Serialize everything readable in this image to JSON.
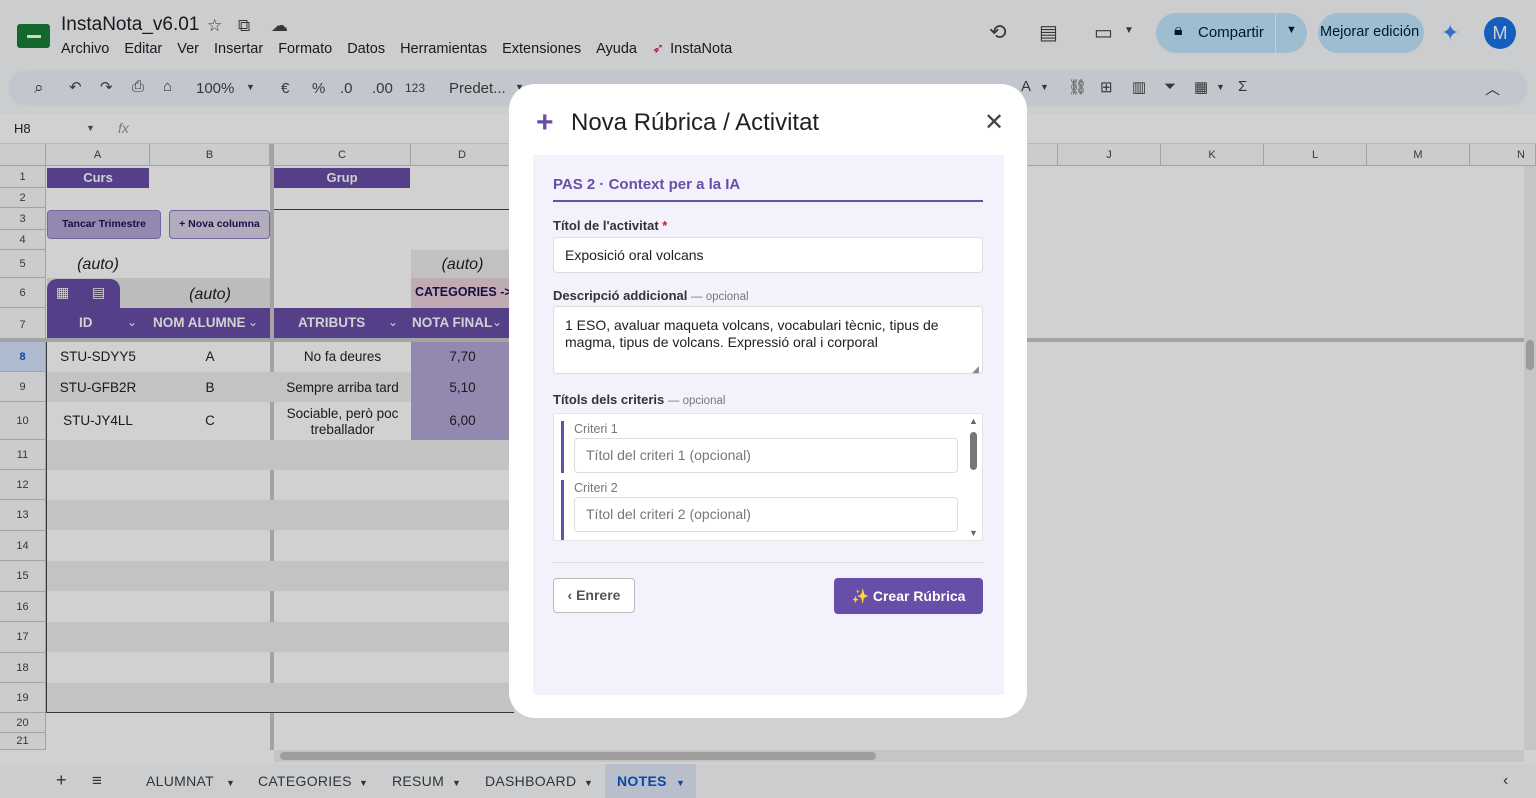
{
  "app": {
    "doc_title": "InstaNota_v6.01",
    "menu": [
      "Archivo",
      "Editar",
      "Ver",
      "Insertar",
      "Formato",
      "Datos",
      "Herramientas",
      "Extensiones",
      "Ayuda",
      "InstaNota"
    ],
    "share_label": "Compartir",
    "improve_label": "Mejorar edición",
    "avatar_letter": "M"
  },
  "toolbar": {
    "zoom": "100%",
    "currency": "€",
    "percent": "%",
    "dec_less": ".0",
    "dec_more": ".00",
    "number_format": "123",
    "font": "Predet..."
  },
  "formula_bar": {
    "cell_ref": "H8",
    "fx": "fx"
  },
  "grid": {
    "columns": [
      "A",
      "B",
      "C",
      "D",
      "J",
      "K",
      "L",
      "M",
      "N"
    ],
    "rows": [
      "1",
      "2",
      "3",
      "4",
      "5",
      "6",
      "7",
      "8",
      "9",
      "10",
      "11",
      "12",
      "13",
      "14",
      "15",
      "16",
      "17",
      "18",
      "19",
      "20",
      "21"
    ],
    "curs_label": "Curs",
    "grup_label": "Grup",
    "close_term": "Tancar Trimestre",
    "new_column": "+ Nova columna",
    "auto": "(auto)",
    "categories_hdr": "CATEGORIES ->",
    "headers": {
      "id": "ID",
      "name": "NOM ALUMNE",
      "attr": "ATRIBUTS",
      "final": "NOTA FINAL"
    },
    "students": [
      {
        "id": "STU-SDYY5",
        "name": "A",
        "attr": "No fa deures",
        "final": "7,70"
      },
      {
        "id": "STU-GFB2R",
        "name": "B",
        "attr": "Sempre arriba tard",
        "final": "5,10"
      },
      {
        "id": "STU-JY4LL",
        "name": "C",
        "attr": "Sociable, però poc treballador",
        "attr_line1": "Sociable, però poc",
        "attr_line2": "treballador",
        "final": "6,00"
      }
    ]
  },
  "sheets": [
    "ALUMNAT",
    "CATEGORIES",
    "RESUM",
    "DASHBOARD",
    "NOTES"
  ],
  "active_sheet": "NOTES",
  "modal": {
    "title": "Nova Rúbrica / Activitat",
    "step": "PAS 2 · Context per a la IA",
    "title_label": "Títol de l'activitat",
    "required_mark": "*",
    "title_value": "Exposició oral volcans",
    "desc_label": "Descripció addicional",
    "optional": "— opcional",
    "desc_value": "1 ESO, avaluar maqueta volcans, vocabulari tècnic, tipus de magma, tipus de volcans. Expressió oral i corporal",
    "criteria_label": "Títols dels criteris",
    "criteria": [
      {
        "label": "Criteri 1",
        "placeholder": "Títol del criteri 1 (opcional)"
      },
      {
        "label": "Criteri 2",
        "placeholder": "Títol del criteri 2 (opcional)"
      }
    ],
    "back_label": "‹ Enrere",
    "create_label": "✨ Crear Rúbrica"
  }
}
